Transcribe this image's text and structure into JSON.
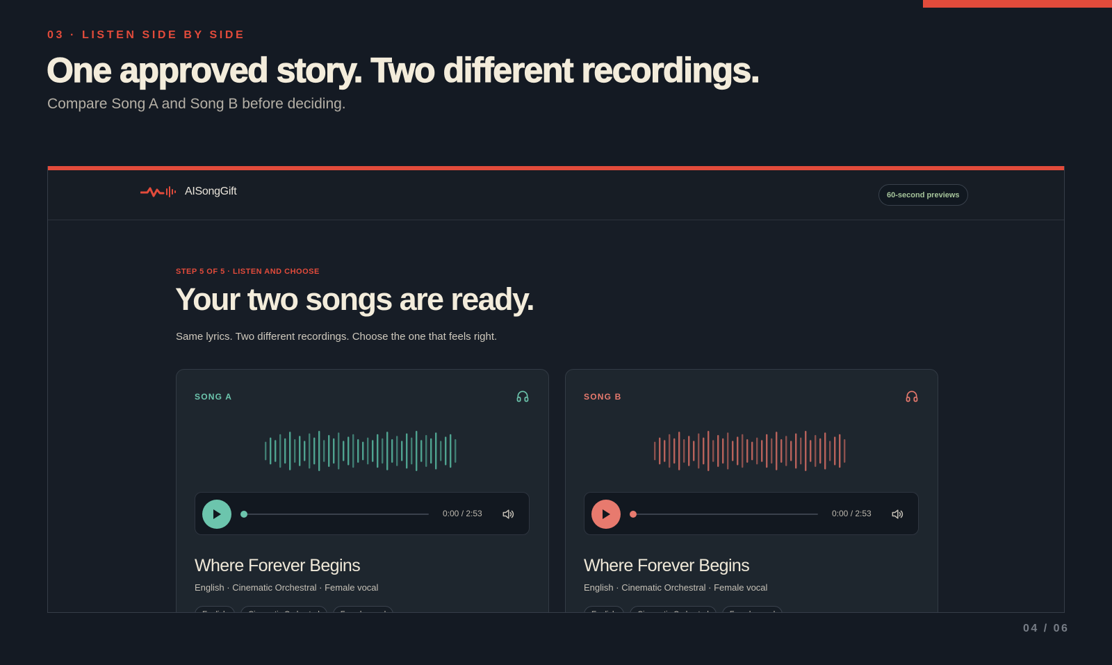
{
  "slide": {
    "eyebrow": "03 · LISTEN SIDE BY SIDE",
    "headline": "One approved story. Two different recordings.",
    "subhead": "Compare Song A and Song B before deciding.",
    "page_counter": "04 / 06",
    "accent_color": "#e24b3b",
    "background_color": "#141a23"
  },
  "app": {
    "brand": "AISongGift",
    "logo_icon": "soundwave-logo-icon",
    "preview_badge": "60-second previews",
    "step_label": "STEP 5 OF 5 · LISTEN AND CHOOSE",
    "title": "Your two songs are ready.",
    "subtitle": "Same lyrics. Two different recordings. Choose the one that feels right."
  },
  "songs": [
    {
      "label": "SONG A",
      "accent_color": "#6cc5ad",
      "icon": "headphones-icon",
      "time": "0:00 / 2:53",
      "progress": 0,
      "title": "Where Forever Begins",
      "meta": "English · Cinematic Orchestral · Female vocal",
      "tags": [
        "English",
        "Cinematic Orchestral",
        "Female vocal"
      ]
    },
    {
      "label": "SONG B",
      "accent_color": "#e87a6e",
      "icon": "headphones-icon",
      "time": "0:00 / 2:53",
      "progress": 0,
      "title": "Where Forever Begins",
      "meta": "English · Cinematic Orchestral · Female vocal",
      "tags": [
        "English",
        "Cinematic Orchestral",
        "Female vocal"
      ]
    }
  ]
}
